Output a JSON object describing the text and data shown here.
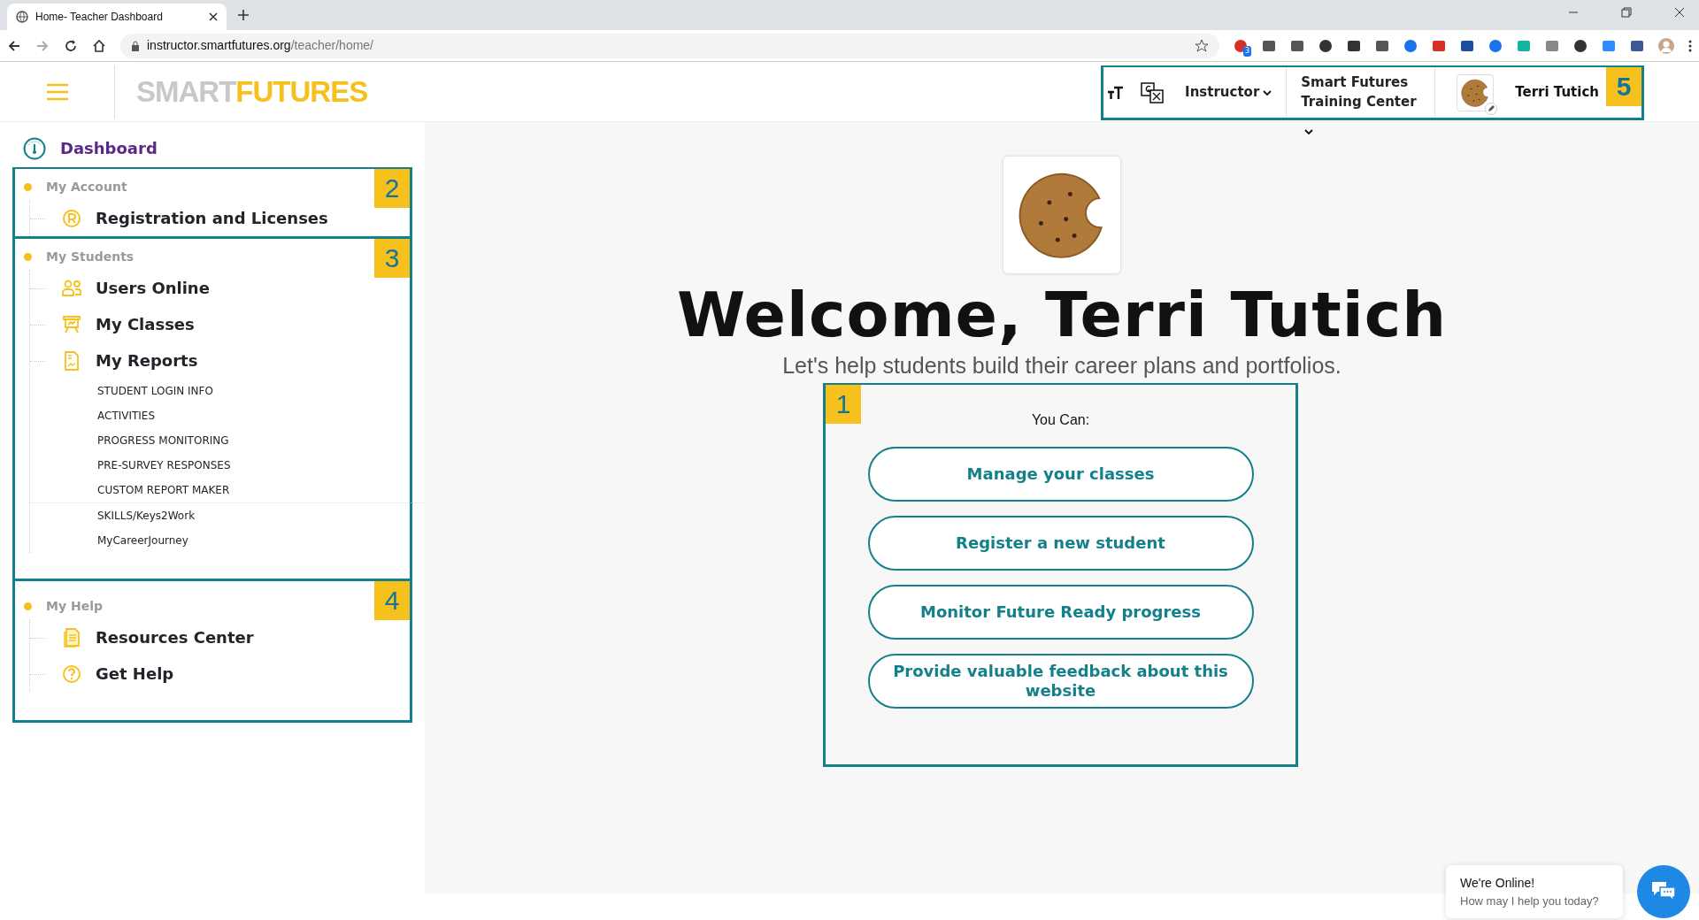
{
  "browser": {
    "tab_title": "Home- Teacher Dashboard",
    "url_host": "instructor.smartfutures.org",
    "url_path": "/teacher/home/",
    "extension_badge": "3"
  },
  "header": {
    "logo": [
      "SMART",
      "FUTURES"
    ],
    "role": "Instructor",
    "organization": "Smart Futures Training Center",
    "user": "Terri Tutich",
    "callout": "5"
  },
  "sidebar": {
    "dashboard": "Dashboard",
    "sections": [
      {
        "title": "My Account",
        "callout": "2",
        "items": [
          {
            "label": "Registration and Licenses"
          }
        ]
      },
      {
        "title": "My Students",
        "callout": "3",
        "items": [
          {
            "label": "Users Online"
          },
          {
            "label": "My Classes"
          },
          {
            "label": "My Reports",
            "children": [
              {
                "label": "STUDENT LOGIN INFO"
              },
              {
                "label": "ACTIVITIES"
              },
              {
                "label": "PROGRESS MONITORING"
              },
              {
                "label": "PRE-SURVEY RESPONSES"
              },
              {
                "label": "CUSTOM REPORT MAKER"
              },
              {
                "label": "SKILLS/Keys2Work"
              },
              {
                "label": "MyCareerJourney"
              }
            ]
          }
        ]
      },
      {
        "title": "My Help",
        "callout": "4",
        "items": [
          {
            "label": "Resources Center"
          },
          {
            "label": "Get Help"
          }
        ]
      }
    ]
  },
  "main": {
    "welcome": "Welcome, Terri Tutich",
    "subtitle": "Let's help students build their career plans and portfolios.",
    "panel": {
      "callout": "1",
      "heading": "You Can:",
      "actions": [
        {
          "label": "Manage your classes"
        },
        {
          "label": "Register a new student"
        },
        {
          "label": "Monitor Future Ready progress"
        },
        {
          "label": "Provide valuable feedback about this website"
        }
      ]
    }
  },
  "chat": {
    "title": "We're Online!",
    "message": "How may I help you today?"
  }
}
